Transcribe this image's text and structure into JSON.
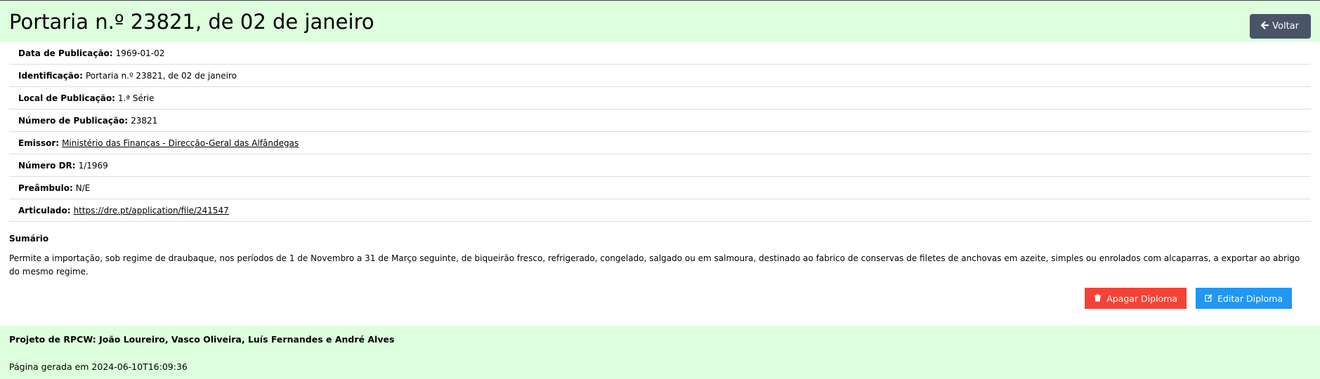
{
  "header": {
    "title": "Portaria n.º 23821, de 02 de janeiro",
    "back_label": "Voltar"
  },
  "details": [
    {
      "label": "Data de Publicação:",
      "value": "1969-01-02"
    },
    {
      "label": "Identificação:",
      "value": "Portaria n.º 23821, de 02 de janeiro"
    },
    {
      "label": "Local de Publicação:",
      "value": "1.ª Série"
    },
    {
      "label": "Número de Publicação:",
      "value": "23821"
    },
    {
      "label": "Emissor:",
      "value": "Ministério das Finanças - Direcção-Geral das Alfândegas"
    },
    {
      "label": "Número DR:",
      "value": "1/1969"
    },
    {
      "label": "Preâmbulo:",
      "value": "N/E"
    },
    {
      "label": "Articulado:",
      "value": "https://dre.pt/application/file/241547"
    }
  ],
  "summary": {
    "heading": "Sumário",
    "text": "Permite a importação, sob regime de draubaque, nos períodos de 1 de Novembro a 31 de Março seguinte, de biqueirão fresco, refrigerado, congelado, salgado ou em salmoura, destinado ao fabrico de conservas de filetes de anchovas em azeite, simples ou enrolados com alcaparras, a exportar ao abrigo do mesmo regime."
  },
  "actions": {
    "delete_label": "Apagar Diploma",
    "edit_label": "Editar Diploma"
  },
  "footer": {
    "authors": "Projeto de RPCW: João Loureiro, Vasco Oliveira, Luís Fernandes e André Alves",
    "generated": "Página gerada em 2024-06-10T16:09:36"
  },
  "colors": {
    "header_bg": "#ddffdd",
    "back_button": "#4a5468",
    "delete_button": "#f44336",
    "edit_button": "#2196f3"
  },
  "icons": {
    "back": "arrow-left-icon",
    "delete": "trash-icon",
    "edit": "edit-icon"
  }
}
